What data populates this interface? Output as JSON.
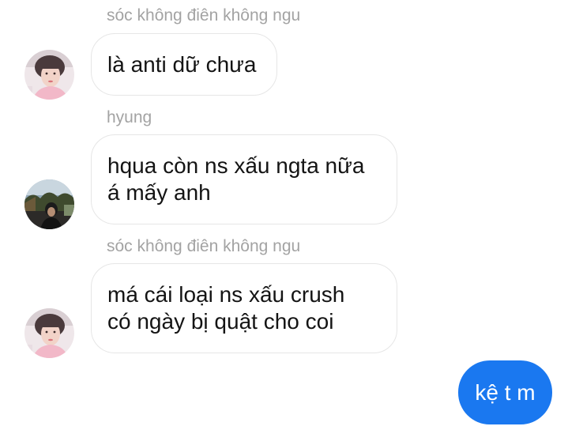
{
  "messages": [
    {
      "sender": "sóc không điên không ngu",
      "lines": [
        "là anti dữ chưa"
      ],
      "avatar": "avatar-boy-pink-shirt"
    },
    {
      "sender": "hyung",
      "lines": [
        "hqua còn ns xấu ngta nữa",
        "á mấy anh"
      ],
      "avatar": "avatar-person-outdoor"
    },
    {
      "sender": "sóc không điên không ngu",
      "lines": [
        "má cái loại ns xấu crush",
        "có ngày bị quật cho coi"
      ],
      "avatar": "avatar-boy-pink-shirt"
    }
  ],
  "outgoing": {
    "text": "kệ t m"
  },
  "colors": {
    "outgoing_bubble": "#1a78f0",
    "sender_name": "#a3a3a3",
    "incoming_border": "#e6e6e6"
  }
}
